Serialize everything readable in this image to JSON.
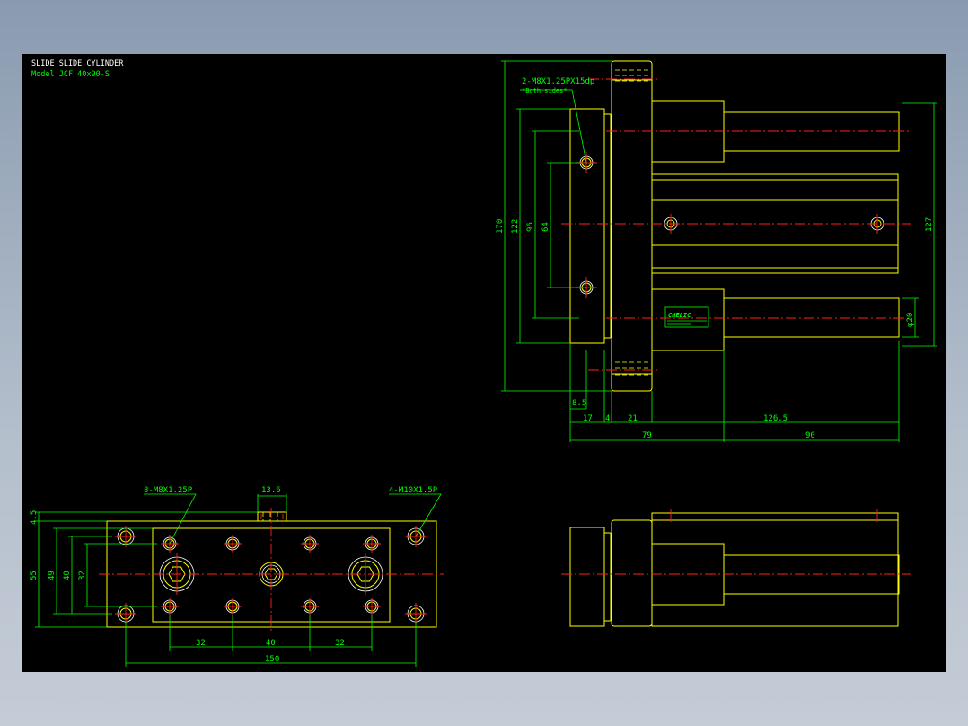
{
  "title_block": {
    "title": "SLIDE SLIDE CYLINDER",
    "model": "Model JCF 40x90-S"
  },
  "annotations": {
    "side_tap": "2-M8X1.25PX15dp",
    "side_tap_note": "*Both sides*",
    "bottom_tap_left": "8-M8X1.25P",
    "bottom_tap_right": "4-M10X1.5P",
    "brand": "CHELIC"
  },
  "dimensions": {
    "d170": "170",
    "d122": "122",
    "d96": "96",
    "d64": "64",
    "d127": "127",
    "dia20": "φ20",
    "d8_5": "8.5",
    "d17": "17",
    "d4": "4",
    "d21": "21",
    "d126_5": "126.5",
    "d79": "79",
    "d90": "90",
    "d13_6": "13.6",
    "d4_5": "4.5",
    "d55": "55",
    "d49": "49",
    "d32v": "32",
    "d32a": "32",
    "d40": "40",
    "d32b": "32",
    "d150": "150"
  }
}
